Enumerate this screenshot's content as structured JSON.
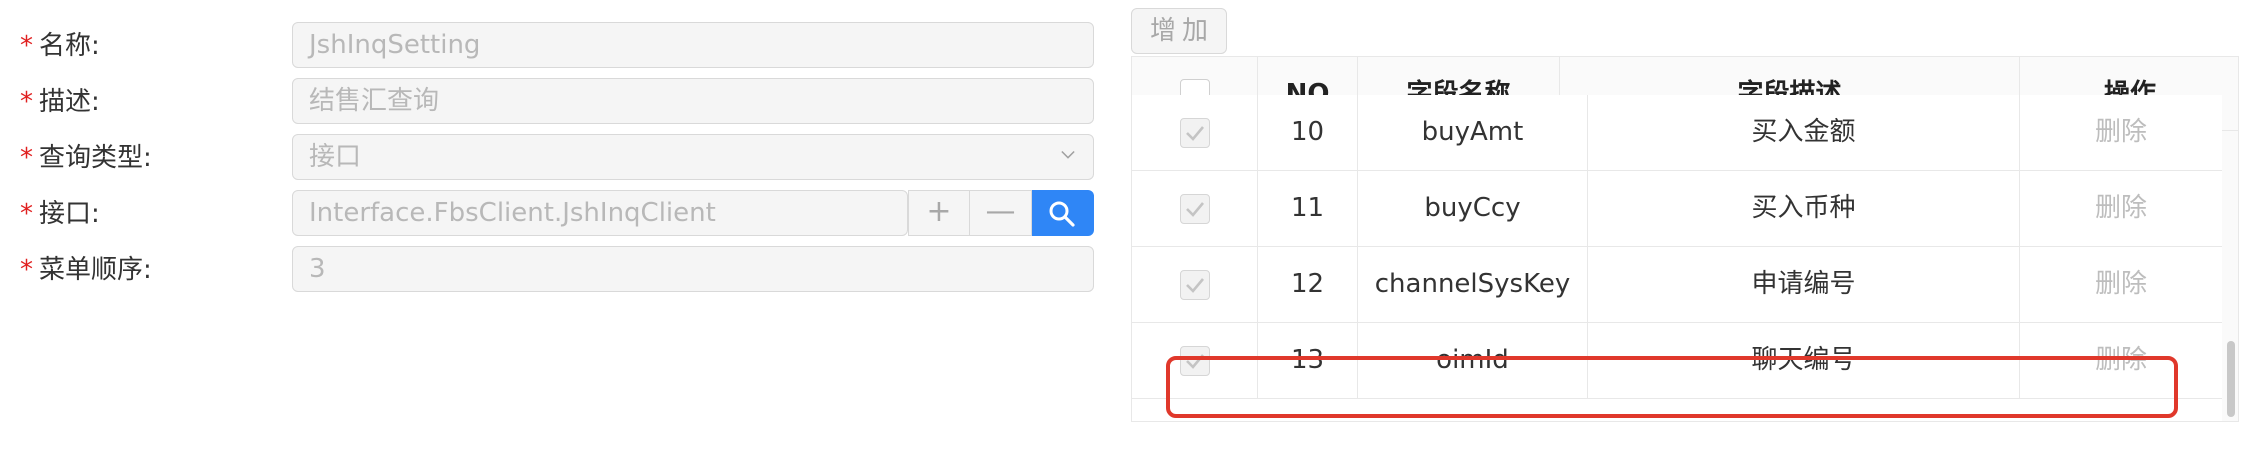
{
  "form": {
    "fields": [
      {
        "label": "名称:",
        "value": "JshInqSetting"
      },
      {
        "label": "描述:",
        "value": "结售汇查询"
      },
      {
        "label": "查询类型:",
        "value": "接口"
      },
      {
        "label": "接口:",
        "value": "Interface.FbsClient.JshInqClient"
      },
      {
        "label": "菜单顺序:",
        "value": "3"
      }
    ],
    "required_mark": "*",
    "plus_symbol": "+",
    "minus_symbol": "—"
  },
  "table": {
    "add_button": "增加",
    "headers": [
      "NO",
      "字段名称",
      "字段描述",
      "操作"
    ],
    "rows": [
      {
        "no": "10",
        "name": "buyAmt",
        "desc": "买入金额",
        "action": "删除",
        "checked": true
      },
      {
        "no": "11",
        "name": "buyCcy",
        "desc": "买入币种",
        "action": "删除",
        "checked": true
      },
      {
        "no": "12",
        "name": "channelSysKey",
        "desc": "申请编号",
        "action": "删除",
        "checked": true
      },
      {
        "no": "13",
        "name": "oimId",
        "desc": "聊天编号",
        "action": "删除",
        "checked": true
      }
    ],
    "highlighted_row": "13"
  },
  "colors": {
    "required": "#e02020",
    "primary": "#2f86f6",
    "highlight": "#e0382b"
  },
  "icons": {
    "select": "chevron-down-icon",
    "search": "search-icon",
    "check": "check-icon"
  }
}
